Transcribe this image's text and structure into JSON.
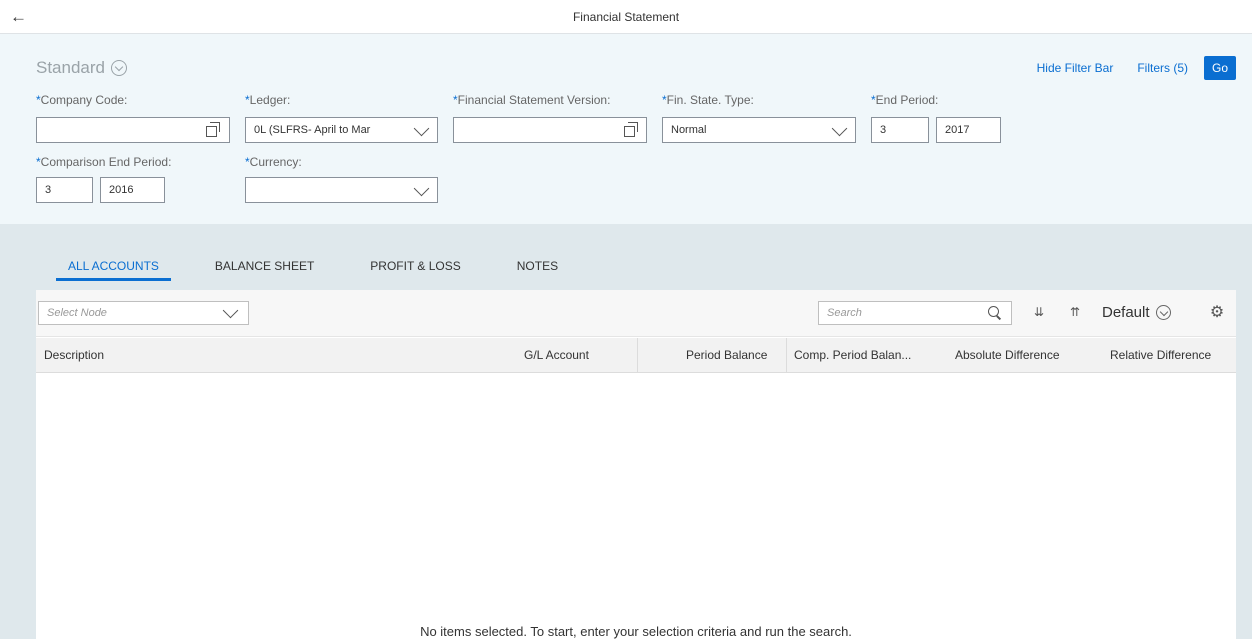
{
  "shell": {
    "title": "Financial Statement"
  },
  "filterbar": {
    "variant": "Standard",
    "hide_filter_bar": "Hide Filter Bar",
    "filters": "Filters (5)",
    "go": "Go",
    "required_marker": "*",
    "fields": {
      "company_code": {
        "label": "Company Code:",
        "value": ""
      },
      "ledger": {
        "label": "Ledger:",
        "value": "0L (SLFRS- April to Mar"
      },
      "fs_version": {
        "label": "Financial Statement Version:",
        "value": ""
      },
      "fs_type": {
        "label": "Fin. State. Type:",
        "value": "Normal"
      },
      "end_period": {
        "label": "End Period:",
        "period": "3",
        "year": "2017"
      },
      "comparison_end_period": {
        "label": "Comparison End Period:",
        "period": "3",
        "year": "2016"
      },
      "currency": {
        "label": "Currency:",
        "value": ""
      }
    }
  },
  "tabs": [
    "ALL ACCOUNTS",
    "BALANCE SHEET",
    "PROFIT & LOSS",
    "NOTES"
  ],
  "toolbar": {
    "select_node_placeholder": "Select Node",
    "search_placeholder": "Search",
    "variant": "Default"
  },
  "table": {
    "columns": [
      "Description",
      "G/L Account",
      "Period Balance",
      "Comp. Period Balan...",
      "Absolute Difference",
      "Relative Difference"
    ],
    "no_data": "No items selected. To start, enter your selection criteria and run the search."
  }
}
